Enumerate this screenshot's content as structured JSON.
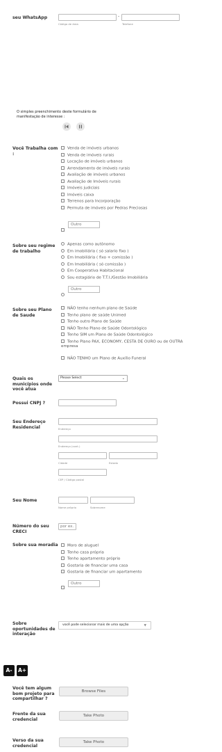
{
  "whatsapp": {
    "label": "seu WhatsApp",
    "dash": "-",
    "area_label": "Código de área",
    "phone_label": "Telefone"
  },
  "media": {
    "caption": "O simples preenchimento deste formulário de manifestação de interesse :"
  },
  "trabalho": {
    "label": "Você Trabalha com :",
    "options": [
      "Venda de imóveis urbanos",
      "Venda de imóveis rurais",
      "Locação de imóveis urbanos",
      "Arrendamento de imóveis rurais",
      "Avaliação de imóveis urbanos",
      "Avaliação de Imóveis rurais",
      "Imóveis judiciais",
      "Imóveis caixa",
      "Terrenos para Incorporação",
      "Permuta de imóveis por Pedras Preciosas"
    ],
    "other_placeholder": "Outro"
  },
  "regime": {
    "label": "Sobre seu regime de trabalho",
    "options": [
      "Apenas como autônomo",
      "Em imobiliária ( só salario fixo )",
      "Em Imobiliária  ( fixo + comissão )",
      "Em Imobiliária ( só comissão )",
      "Em Cooperativa Habitacional",
      "Sou estagiário de T.T.I./Gestão Imobiliária"
    ],
    "other_placeholder": "Outro"
  },
  "saude": {
    "label": "Sobre seu Plano de Saude",
    "options": [
      "NÃO  tenho nenhum plano de Saúde",
      "Tenho plano de saúde Unimed",
      "Tenho outro Plano de Saúde",
      "NÃO Tenho Plano de Saúde Odontológico",
      "Tenho SIM um Plano de Saúde Odontológico",
      "Tenho Plano PAX, ECONOMY, CESTA DE OURO ou de OUTRA empresa",
      "NÃO TENHO um Plano de Auxílio Funeral"
    ]
  },
  "municipios": {
    "label": "Quais os municípios onde você atua",
    "select_value": "Please Select"
  },
  "cnpj": {
    "label": "Possui CNPJ ?"
  },
  "endereco": {
    "label": "Seu Endereço Residencial",
    "line1": "Endereço",
    "line2": "Endereço (cont.)",
    "city": "Cidade",
    "state": "Estado",
    "zip": "CEP / Código postal"
  },
  "nome": {
    "label": "Seu Nome",
    "first": "Nome próprio",
    "last": "Sobrenome"
  },
  "creci": {
    "label": "Número do seu CRECI",
    "placeholder": "por ex."
  },
  "moradia": {
    "label": "Sobre sua moradia",
    "options": [
      "Moro de aluguel",
      "Tenho casa própria",
      "Tenho apartamento próprio",
      "Gostaria de financiar uma casa",
      "Gostaria de financiar um apartamento"
    ],
    "other_placeholder": "Outro"
  },
  "oportunidades": {
    "label": "Sobre oportunidades de interação",
    "select_value": "você pode selecionar mais de uma opção"
  },
  "font_controls": {
    "decrease": "A-",
    "increase": "A+"
  },
  "projeto": {
    "label": "Você tem algum bom projeto para compartilhar ?",
    "button": "Browse Files"
  },
  "frente": {
    "label": "Frente da sua credencial",
    "button": "Take Photo"
  },
  "verso": {
    "label": "Verso da sua credencial",
    "button": "Take Photo"
  },
  "colors": {
    "border": "#bbbbbb",
    "button_bg": "#eeeeee",
    "font_btn_bg": "#111111"
  }
}
